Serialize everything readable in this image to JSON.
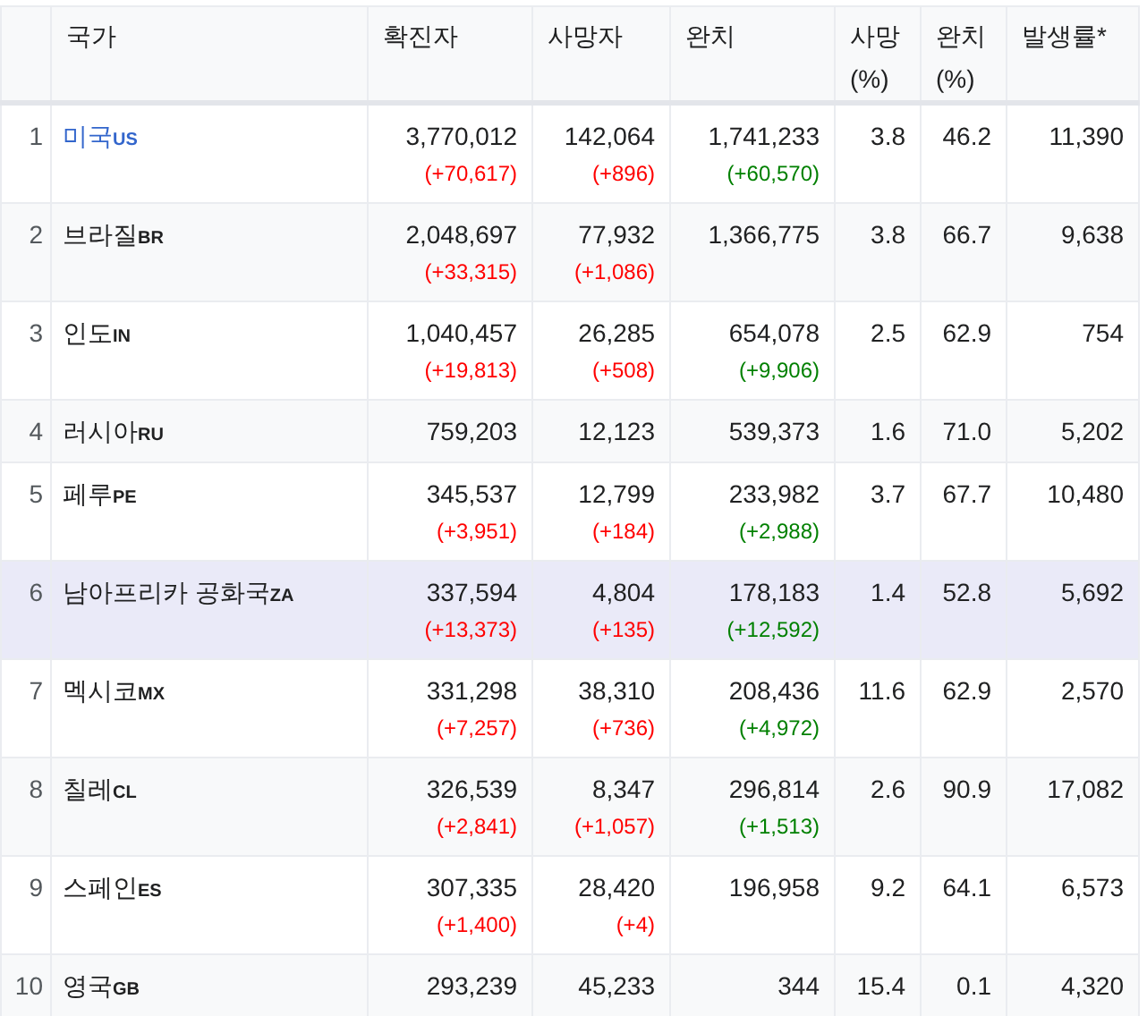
{
  "table": {
    "columns": [
      "국가",
      "확진자",
      "사망자",
      "완치",
      "사망 (%)",
      "완치 (%)",
      "발생률*"
    ],
    "rows": [
      {
        "rank": "1",
        "country": "미국",
        "code": "US",
        "link": true,
        "selected": false,
        "confirmed": "3,770,012",
        "confirmed_delta": "(+70,617)",
        "deaths": "142,064",
        "deaths_delta": "(+896)",
        "recovered": "1,741,233",
        "recovered_delta": "(+60,570)",
        "death_rate": "3.8",
        "recovery_rate": "46.2",
        "incidence": "11,390"
      },
      {
        "rank": "2",
        "country": "브라질",
        "code": "BR",
        "link": false,
        "selected": false,
        "confirmed": "2,048,697",
        "confirmed_delta": "(+33,315)",
        "deaths": "77,932",
        "deaths_delta": "(+1,086)",
        "recovered": "1,366,775",
        "death_rate": "3.8",
        "recovery_rate": "66.7",
        "incidence": "9,638"
      },
      {
        "rank": "3",
        "country": "인도",
        "code": "IN",
        "link": false,
        "selected": false,
        "confirmed": "1,040,457",
        "confirmed_delta": "(+19,813)",
        "deaths": "26,285",
        "deaths_delta": "(+508)",
        "recovered": "654,078",
        "recovered_delta": "(+9,906)",
        "death_rate": "2.5",
        "recovery_rate": "62.9",
        "incidence": "754"
      },
      {
        "rank": "4",
        "country": "러시아",
        "code": "RU",
        "link": false,
        "selected": false,
        "confirmed": "759,203",
        "deaths": "12,123",
        "recovered": "539,373",
        "death_rate": "1.6",
        "recovery_rate": "71.0",
        "incidence": "5,202"
      },
      {
        "rank": "5",
        "country": "페루",
        "code": "PE",
        "link": false,
        "selected": false,
        "confirmed": "345,537",
        "confirmed_delta": "(+3,951)",
        "deaths": "12,799",
        "deaths_delta": "(+184)",
        "recovered": "233,982",
        "recovered_delta": "(+2,988)",
        "death_rate": "3.7",
        "recovery_rate": "67.7",
        "incidence": "10,480"
      },
      {
        "rank": "6",
        "country": "남아프리카 공화국",
        "code": "ZA",
        "link": false,
        "selected": true,
        "confirmed": "337,594",
        "confirmed_delta": "(+13,373)",
        "deaths": "4,804",
        "deaths_delta": "(+135)",
        "recovered": "178,183",
        "recovered_delta": "(+12,592)",
        "death_rate": "1.4",
        "recovery_rate": "52.8",
        "incidence": "5,692"
      },
      {
        "rank": "7",
        "country": "멕시코",
        "code": "MX",
        "link": false,
        "selected": false,
        "confirmed": "331,298",
        "confirmed_delta": "(+7,257)",
        "deaths": "38,310",
        "deaths_delta": "(+736)",
        "recovered": "208,436",
        "recovered_delta": "(+4,972)",
        "death_rate": "11.6",
        "recovery_rate": "62.9",
        "incidence": "2,570"
      },
      {
        "rank": "8",
        "country": "칠레",
        "code": "CL",
        "link": false,
        "selected": false,
        "confirmed": "326,539",
        "confirmed_delta": "(+2,841)",
        "deaths": "8,347",
        "deaths_delta": "(+1,057)",
        "recovered": "296,814",
        "recovered_delta": "(+1,513)",
        "death_rate": "2.6",
        "recovery_rate": "90.9",
        "incidence": "17,082"
      },
      {
        "rank": "9",
        "country": "스페인",
        "code": "ES",
        "link": false,
        "selected": false,
        "confirmed": "307,335",
        "confirmed_delta": "(+1,400)",
        "deaths": "28,420",
        "deaths_delta": "(+4)",
        "recovered": "196,958",
        "death_rate": "9.2",
        "recovery_rate": "64.1",
        "incidence": "6,573"
      },
      {
        "rank": "10",
        "country": "영국",
        "code": "GB",
        "link": false,
        "selected": false,
        "confirmed": "293,239",
        "deaths": "45,233",
        "recovered": "344",
        "death_rate": "15.4",
        "recovery_rate": "0.1",
        "incidence": "4,320"
      }
    ]
  }
}
